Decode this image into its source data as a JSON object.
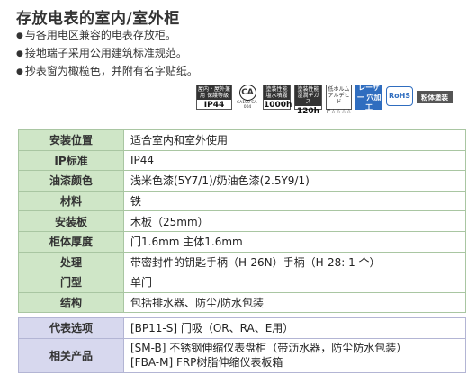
{
  "title": "存放电表的室内/室外柜",
  "bullets": [
    "与各用电区兼容的电表存放柜。",
    "接地端子采用公用建筑标准规范。",
    "抄表窗为橄榄色，并附有名字贴纸。"
  ],
  "icons": {
    "ip": {
      "top": "屋内・屋外兼用 保護等級",
      "main": "IP44"
    },
    "ca": {
      "main": "CA",
      "sub": "CA100 CA-004"
    },
    "paint1000": {
      "top": "塗装性能 塩水噴霧",
      "main": "1000h"
    },
    "paint120": {
      "top": "塗装性能 湿潤デガス",
      "main": "120h"
    },
    "formaldehyde": {
      "top": "低ホルム アルデヒド",
      "main": "F☆☆☆☆"
    },
    "laser": {
      "main": "レーザー 穴加工"
    },
    "rohs": {
      "main": "RoHS"
    },
    "powder": {
      "main": "粉体塗装"
    },
    "colors": {
      "laser": "#2f6dbf",
      "powder": "#555555",
      "spec_label_bg": "#cfe6c7",
      "option_label_bg": "#d7d8ee"
    }
  },
  "specs": [
    {
      "label": "安装位置",
      "value": "适合室内和室外使用"
    },
    {
      "label": "IP标准",
      "value": "IP44"
    },
    {
      "label": "油漆颜色",
      "value": "浅米色漆(5Y7/1)/奶油色漆(2.5Y9/1)"
    },
    {
      "label": "材料",
      "value": "铁"
    },
    {
      "label": "安装板",
      "value": "木板（25mm）"
    },
    {
      "label": "柜体厚度",
      "value": "门1.6mm 主体1.6mm"
    },
    {
      "label": "处理",
      "value": "带密封件的钥匙手柄（H-26N）手柄（H-28: 1 个）"
    },
    {
      "label": "门型",
      "value": "单门"
    },
    {
      "label": "结构",
      "value": "包括排水器、防尘/防水包装"
    }
  ],
  "options": [
    {
      "label": "代表选项",
      "lines": [
        "[BP11-S] 门吸（OR、RA、E用）"
      ]
    },
    {
      "label": "相关产品",
      "lines": [
        "[SM-B] 不锈钢伸缩仪表盘柜（带沥水器，防尘防水包装）",
        "[FBA-M] FRP树脂伸缩仪表板箱"
      ]
    }
  ]
}
